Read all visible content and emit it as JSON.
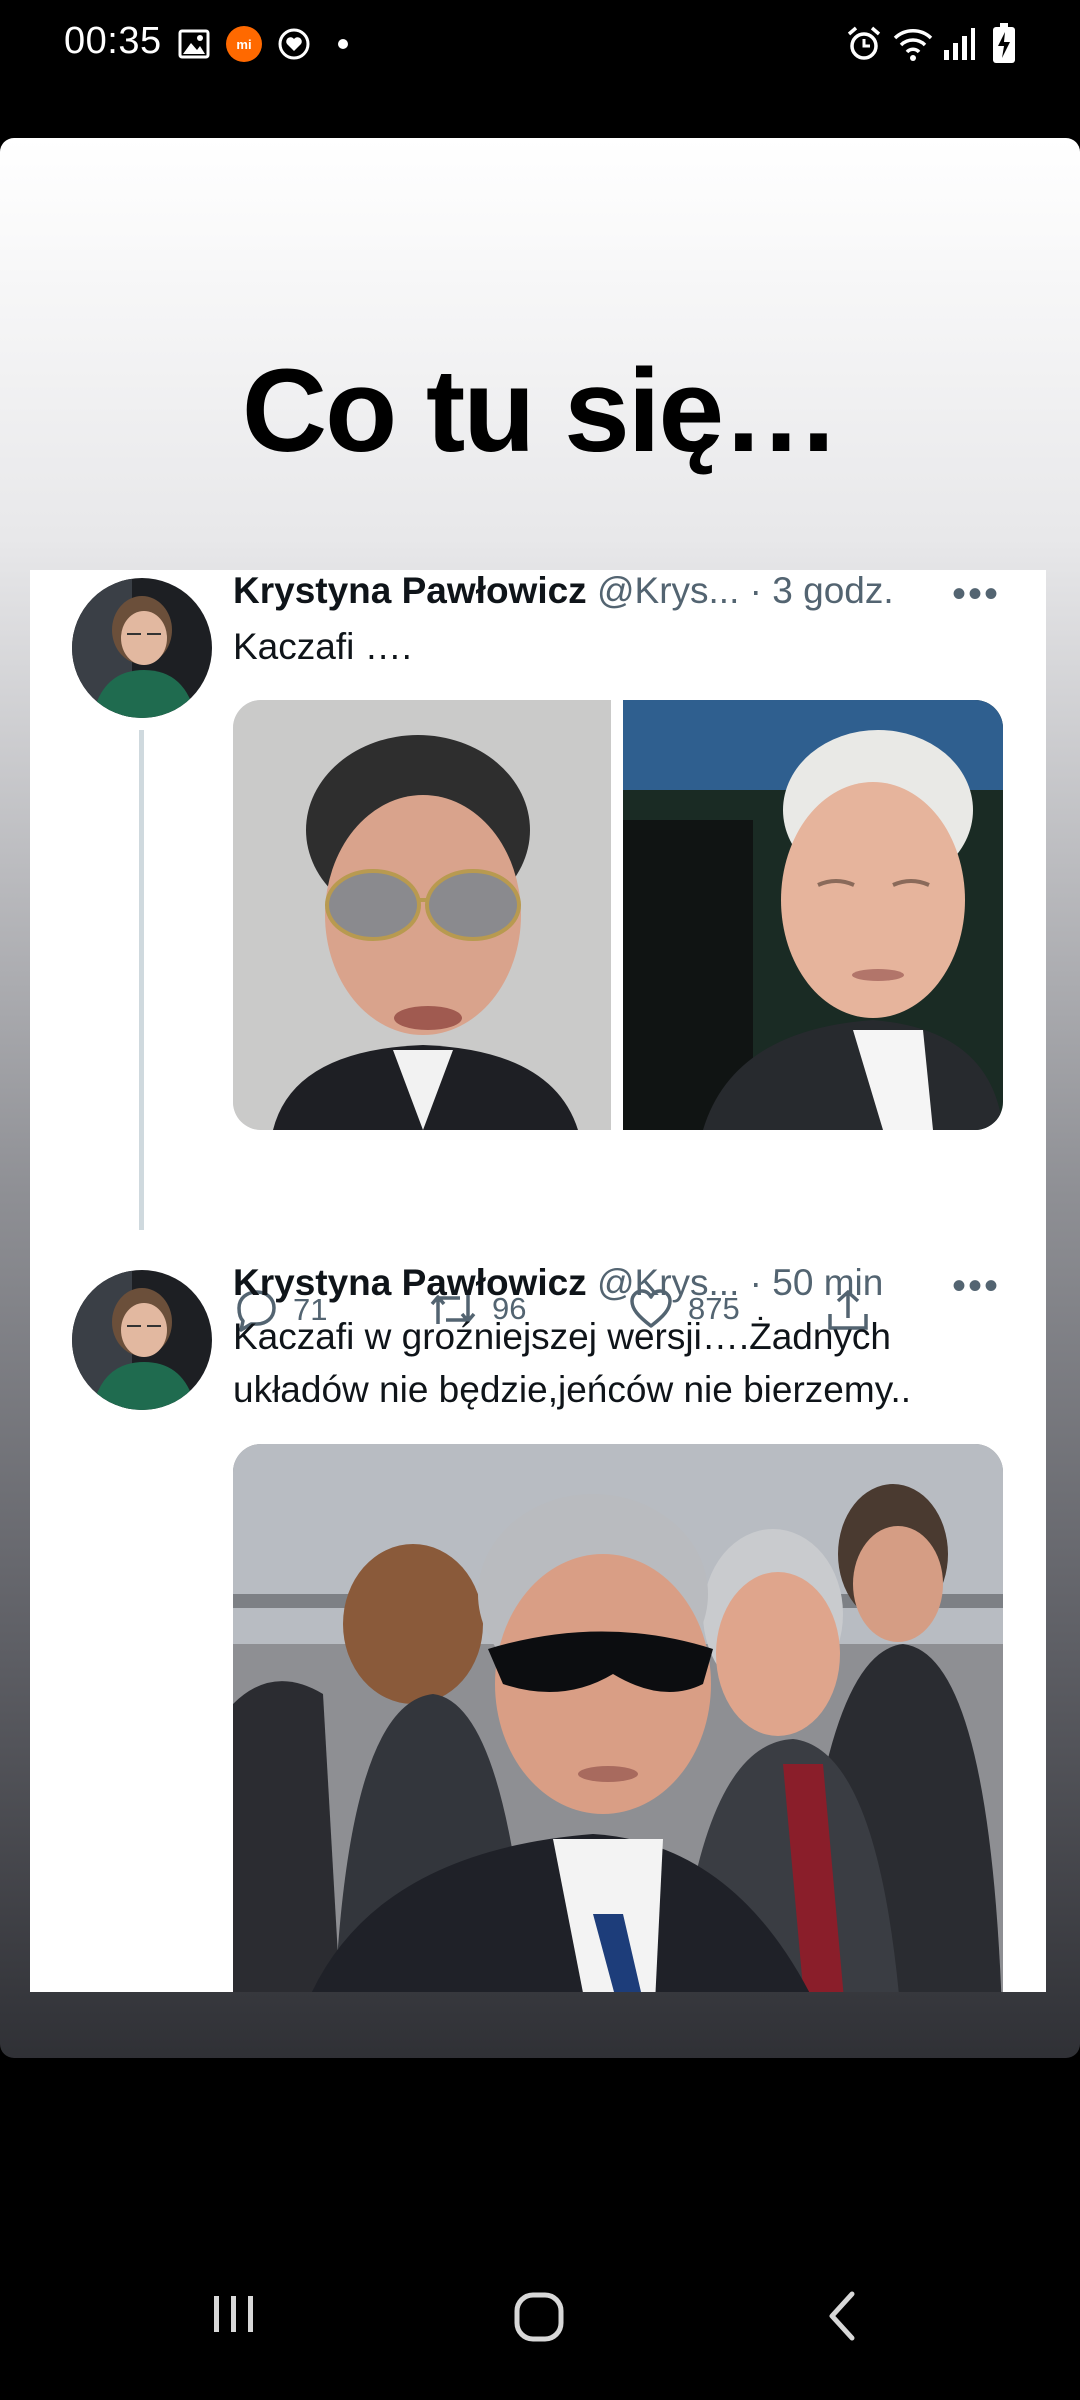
{
  "status_bar": {
    "time": "00:35",
    "left_icons": [
      "gallery-icon",
      "mi-app-icon",
      "heart-sync-icon",
      "dot-icon"
    ],
    "right_icons": [
      "alarm-icon",
      "wifi-icon",
      "signal-icon",
      "battery-charging-icon"
    ]
  },
  "story": {
    "headline": "Co tu się…"
  },
  "tweets": [
    {
      "name": "Krystyna Pawłowicz",
      "handle": "@Krys...",
      "time": "· 3 godz.",
      "more": "•••",
      "text": "Kaczafi ….",
      "replies": "71",
      "retweets": "96",
      "likes": "875"
    },
    {
      "name": "Krystyna Pawłowicz",
      "handle": "@Krys...",
      "time": "· 50 min",
      "more": "•••",
      "text": "Kaczafi w groźniejszej wersji….Żadnych układów nie będzie,jeńców nie bierzemy.."
    }
  ],
  "colors": {
    "twitter_gray": "#536471",
    "thread_line": "#cfd9de",
    "mi_orange": "#ff6900"
  }
}
